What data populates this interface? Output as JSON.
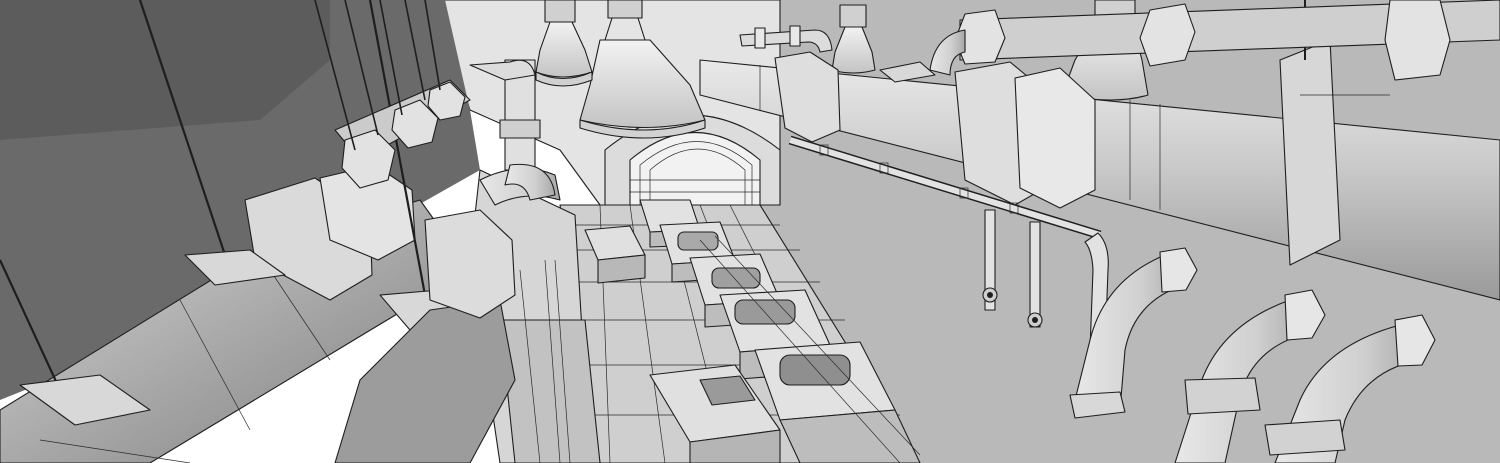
{
  "scene": {
    "kind": "3d-sketch-render",
    "subject": "industrial-pipe-corridor",
    "style": "grayscale-outlined",
    "colors": {
      "dark_wall": "#6a6a6a",
      "light_wall": "#b9b9b9",
      "far_wall": "#e4e4e4",
      "floor": "#cfcfcf",
      "pipe_light": "#e6e6e6",
      "pipe_mid": "#bdbdbd",
      "pipe_dark": "#8c8c8c",
      "outline": "#1e1e1e"
    }
  }
}
